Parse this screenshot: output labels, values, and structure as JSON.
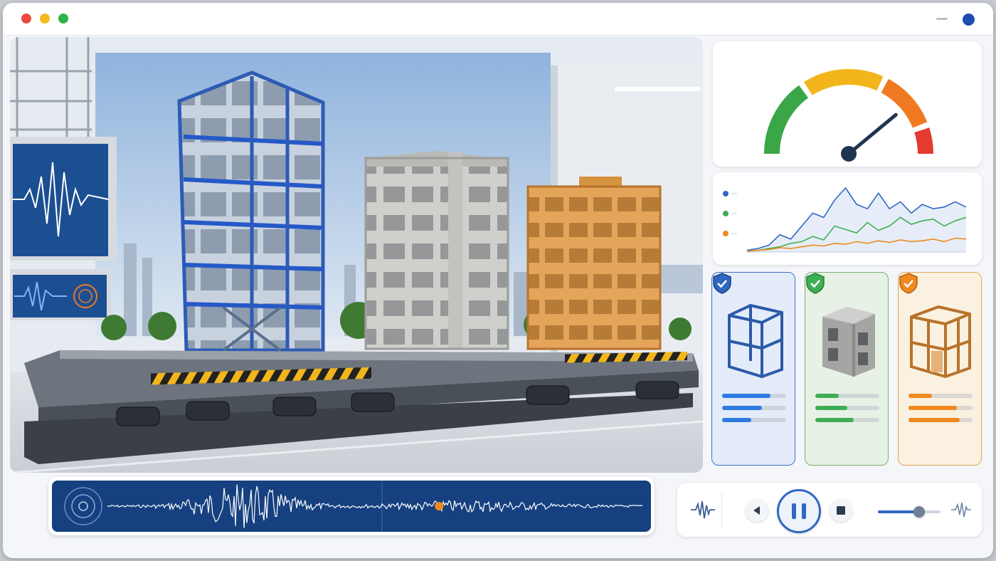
{
  "colors": {
    "accent_blue": "#2f68c3",
    "steel": "#2f7be0",
    "concrete": "#3eae52",
    "timber": "#ef8a1e",
    "gauge_green": "#3aa648",
    "gauge_yellow": "#f2b61c",
    "gauge_orange": "#f07a22",
    "gauge_red": "#e43b2e"
  },
  "gauge": {
    "level": 0.78,
    "icon": "gauge-icon"
  },
  "chart_data": {
    "type": "line",
    "series": [
      {
        "color": "#2f68c3",
        "values": [
          2,
          4,
          8,
          20,
          15,
          30,
          45,
          40,
          60,
          74,
          55,
          50,
          68,
          50,
          58,
          45,
          55,
          50,
          52,
          58,
          52
        ]
      },
      {
        "color": "#3eae52",
        "values": [
          1,
          2,
          4,
          6,
          10,
          12,
          18,
          14,
          30,
          26,
          22,
          34,
          25,
          30,
          40,
          32,
          36,
          38,
          30,
          36,
          40
        ]
      },
      {
        "color": "#ef8a1e",
        "values": [
          1,
          2,
          3,
          5,
          4,
          6,
          8,
          7,
          10,
          9,
          12,
          10,
          13,
          11,
          14,
          12,
          13,
          15,
          12,
          16,
          15
        ]
      }
    ],
    "legend": "left",
    "grid": false
  },
  "structures": [
    {
      "id": "steel",
      "bars": [
        0.75,
        0.62,
        0.45
      ],
      "icon": "steel-frame-icon"
    },
    {
      "id": "concrete",
      "bars": [
        0.37,
        0.5,
        0.6
      ],
      "icon": "concrete-frame-icon"
    },
    {
      "id": "timber",
      "bars": [
        0.37,
        0.75,
        0.8
      ],
      "icon": "timber-frame-icon"
    }
  ],
  "playback": {
    "state": "playing",
    "amplitude": 0.66,
    "position": 0.62
  }
}
